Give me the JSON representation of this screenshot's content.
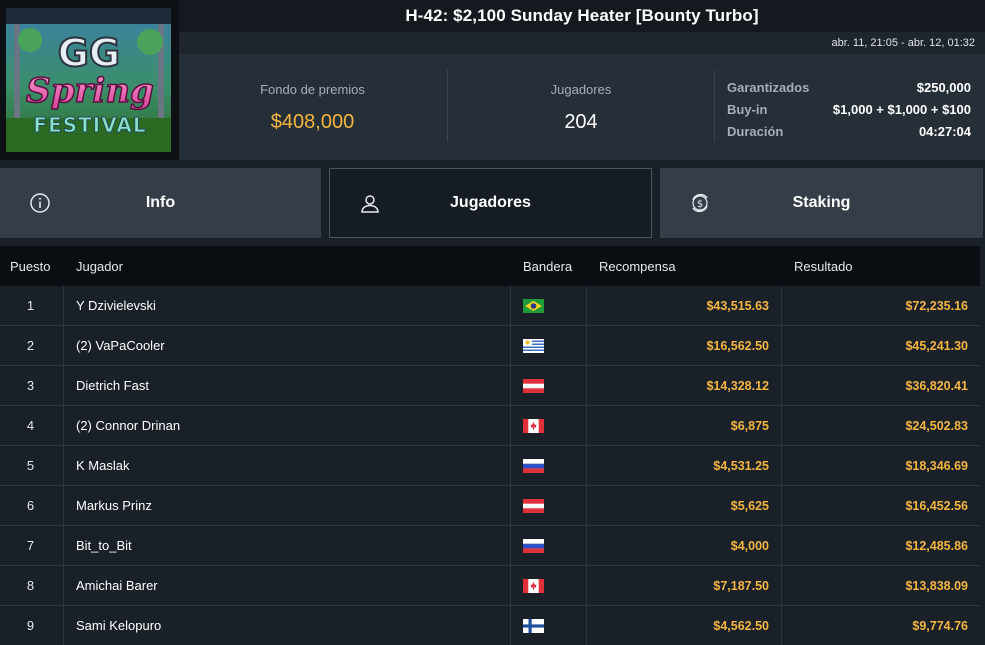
{
  "logo": {
    "line1": "GG",
    "line2": "Spring",
    "line3": "FESTIVAL"
  },
  "header": {
    "title": "H-42: $2,100 Sunday Heater [Bounty Turbo]",
    "dates": "abr. 11, 21:05 - abr. 12, 01:32"
  },
  "stats": {
    "prize_label": "Fondo de premios",
    "prize_value": "$408,000",
    "players_label": "Jugadores",
    "players_value": "204",
    "details": [
      {
        "label": "Garantizados",
        "value": "$250,000"
      },
      {
        "label": "Buy-in",
        "value": "$1,000 + $1,000 + $100"
      },
      {
        "label": "Duración",
        "value": "04:27:04"
      }
    ]
  },
  "tabs": [
    {
      "label": "Info",
      "icon": "info-icon"
    },
    {
      "label": "Jugadores",
      "icon": "user-icon"
    },
    {
      "label": "Staking",
      "icon": "dollar-cycle-icon"
    }
  ],
  "table": {
    "headers": {
      "pos": "Puesto",
      "player": "Jugador",
      "flag": "Bandera",
      "reward": "Recompensa",
      "result": "Resultado"
    },
    "rows": [
      {
        "pos": "1",
        "player": "Y Dzivielevski",
        "flag": "brazil",
        "reward": "$43,515.63",
        "result": "$72,235.16"
      },
      {
        "pos": "2",
        "player": "(2) VaPaCooler",
        "flag": "uruguay",
        "reward": "$16,562.50",
        "result": "$45,241.30"
      },
      {
        "pos": "3",
        "player": "Dietrich Fast",
        "flag": "austria",
        "reward": "$14,328.12",
        "result": "$36,820.41"
      },
      {
        "pos": "4",
        "player": "(2) Connor Drinan",
        "flag": "canada",
        "reward": "$6,875",
        "result": "$24,502.83"
      },
      {
        "pos": "5",
        "player": "K Maslak",
        "flag": "russia",
        "reward": "$4,531.25",
        "result": "$18,346.69"
      },
      {
        "pos": "6",
        "player": "Markus Prinz",
        "flag": "austria",
        "reward": "$5,625",
        "result": "$16,452.56"
      },
      {
        "pos": "7",
        "player": "Bit_to_Bit",
        "flag": "russia",
        "reward": "$4,000",
        "result": "$12,485.86"
      },
      {
        "pos": "8",
        "player": "Amichai Barer",
        "flag": "canada",
        "reward": "$7,187.50",
        "result": "$13,838.09"
      },
      {
        "pos": "9",
        "player": "Sami Kelopuro",
        "flag": "finland",
        "reward": "$4,562.50",
        "result": "$9,774.76"
      }
    ]
  },
  "colors": {
    "accent_gold": "#f4b63f",
    "bg": "#1a2028",
    "panel": "#262e38",
    "tab": "#343d48"
  }
}
